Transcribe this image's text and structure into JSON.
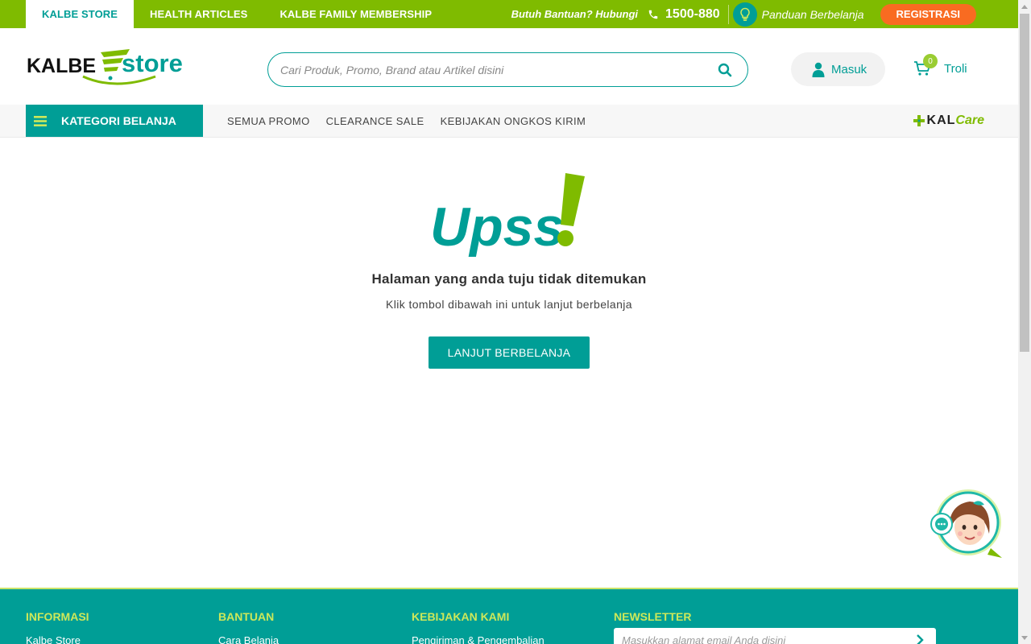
{
  "topbar": {
    "tabs": [
      "KALBE STORE",
      "HEALTH ARTICLES",
      "KALBE FAMILY MEMBERSHIP"
    ],
    "help_text": "Butuh Bantuan? Hubungi",
    "phone": "1500-880",
    "guide_text": "Panduan Berbelanja",
    "register_label": "REGISTRASI"
  },
  "header": {
    "logo_text": "KALBE store",
    "search_placeholder": "Cari Produk, Promo, Brand atau Artikel disini",
    "login_label": "Masuk",
    "cart_count": "0",
    "cart_label": "Troli"
  },
  "nav": {
    "category_label": "KATEGORI BELANJA",
    "links": [
      "SEMUA PROMO",
      "CLEARANCE SALE",
      "KEBIJAKAN ONGKOS KIRIM"
    ],
    "partner_kal": "KAL",
    "partner_care": "Care"
  },
  "main": {
    "headline": "Upss",
    "title": "Halaman yang anda tuju tidak ditemukan",
    "subtitle": "Klik tombol dibawah ini untuk lanjut berbelanja",
    "cta_label": "LANJUT BERBELANJA"
  },
  "footer": {
    "columns": [
      {
        "heading": "INFORMASI",
        "link": "Kalbe Store"
      },
      {
        "heading": "BANTUAN",
        "link": "Cara Belanja"
      },
      {
        "heading": "KEBIJAKAN KAMI",
        "link": "Pengiriman & Pengembalian"
      },
      {
        "heading": "NEWSLETTER",
        "link": ""
      }
    ],
    "newsletter_placeholder": "Masukkan alamat email Anda disini"
  },
  "colors": {
    "brand_green": "#7fbb00",
    "brand_teal": "#009e96",
    "accent_orange": "#f96b21"
  },
  "icons": [
    "phone-icon",
    "lightbulb-icon",
    "search-icon",
    "user-icon",
    "cart-icon",
    "menu-icon",
    "kalcare-cross-icon",
    "chat-icon",
    "chevron-right-icon"
  ]
}
